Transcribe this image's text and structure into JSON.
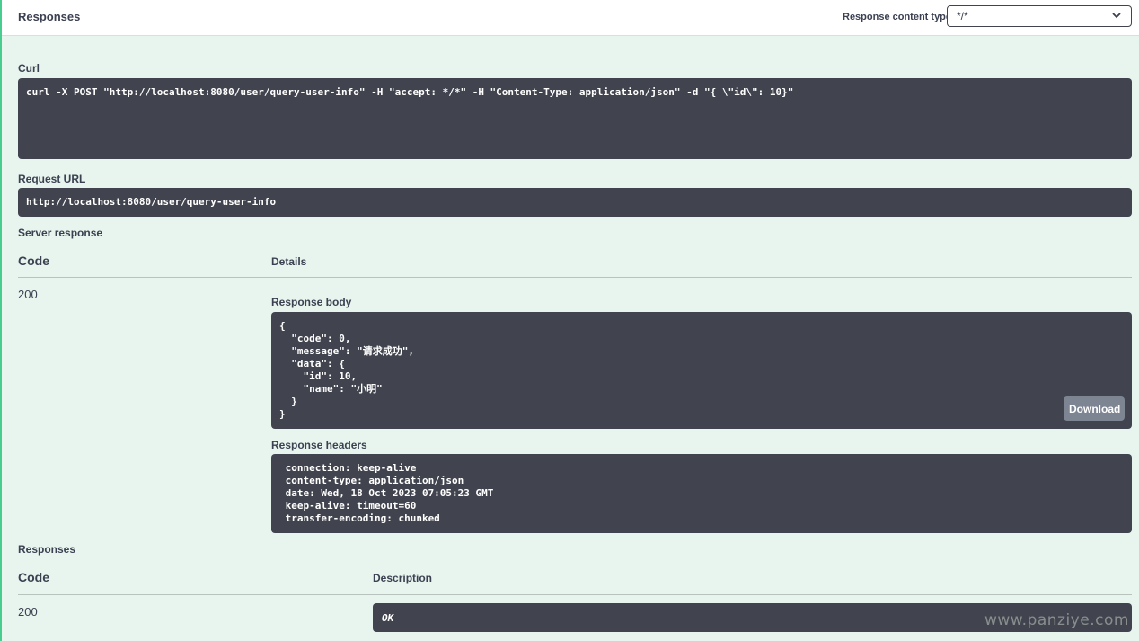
{
  "header": {
    "title": "Responses",
    "content_type_label": "Response content type",
    "content_type_value": "*/*",
    "chevron_glyph": "⌄"
  },
  "curl": {
    "label": "Curl",
    "command": "curl -X POST \"http://localhost:8080/user/query-user-info\" -H \"accept: */*\" -H \"Content-Type: application/json\" -d \"{ \\\"id\\\": 10}\""
  },
  "request_url": {
    "label": "Request URL",
    "value": "http://localhost:8080/user/query-user-info"
  },
  "server_response": {
    "label": "Server response",
    "code_header": "Code",
    "details_header": "Details",
    "code": "200",
    "body_label": "Response body",
    "body": "{\n  \"code\": 0,\n  \"message\": \"请求成功\",\n  \"data\": {\n    \"id\": 10,\n    \"name\": \"小明\"\n  }\n}",
    "download_label": "Download",
    "headers_label": "Response headers",
    "headers": " connection: keep-alive\n content-type: application/json\n date: Wed, 18 Oct 2023 07:05:23 GMT\n keep-alive: timeout=60\n transfer-encoding: chunked"
  },
  "responses": {
    "label": "Responses",
    "code_header": "Code",
    "description_header": "Description",
    "code": "200",
    "description": "OK"
  },
  "watermark": "www.panziye.com",
  "colors": {
    "accent_green": "#49cc90",
    "background": "#e8f5ee",
    "code_block": "#41444e",
    "button": "#7d8492"
  }
}
